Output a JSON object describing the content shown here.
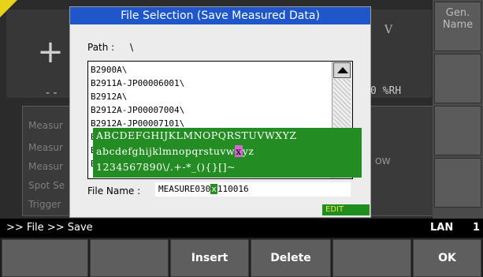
{
  "dialog": {
    "title": "File Selection (Save Measured Data)",
    "path_label": "Path :",
    "path_value": "\\",
    "files": [
      "B2900A\\",
      "B2911A-JP00006001\\",
      "B2912A\\",
      "B2912A-JP00007004\\",
      "B2912A-JP00007101\\",
      "B",
      "B",
      "B"
    ],
    "filename_label": "File Name :",
    "filename_before": "MEASURE030",
    "filename_cursor": "x",
    "filename_after": "110016",
    "edit_tag": "EDIT"
  },
  "keyboard": {
    "row1": "ABCDEFGHIJKLMNOPQRSTUVWXYZ",
    "row2_before": "abcdefghijklmnopqrstuvw",
    "row2_selected": "x",
    "row2_after": "yz",
    "row3": "1234567890\\/.+-*_(){}[]~"
  },
  "background": {
    "plus": "+",
    "dashes": "- -",
    "unit_v": "V",
    "unit_rh": "0 %RH",
    "menu_lines": [
      "Measur",
      "Measur",
      "Measur",
      "Spot Se",
      "Trigger"
    ],
    "ow": "OW"
  },
  "right_keys": [
    {
      "label": "Gen.\nName"
    },
    {
      "label": ""
    },
    {
      "label": ""
    },
    {
      "label": ""
    }
  ],
  "status": {
    "breadcrumb": ">> File >> Save",
    "lan": "LAN",
    "lan_number": "1"
  },
  "softkeys": [
    "",
    "",
    "Insert",
    "Delete",
    "",
    "OK"
  ],
  "colors": {
    "title_bar": "#1f56c9",
    "keyboard": "#238c23",
    "selected_key": "#d36ad3",
    "edit_text": "#f1e94a"
  }
}
